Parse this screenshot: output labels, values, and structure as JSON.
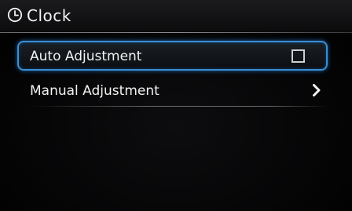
{
  "header": {
    "title": "Clock",
    "icon": "clock-icon"
  },
  "menu": {
    "items": [
      {
        "label": "Auto Adjustment",
        "control": "checkbox",
        "checked": false,
        "selected": true
      },
      {
        "label": "Manual Adjustment",
        "control": "chevron-right-icon",
        "selected": false
      }
    ]
  },
  "colors": {
    "selection_outline": "#3a8fd6",
    "background": "#000000",
    "text": "#f2f2f2"
  }
}
